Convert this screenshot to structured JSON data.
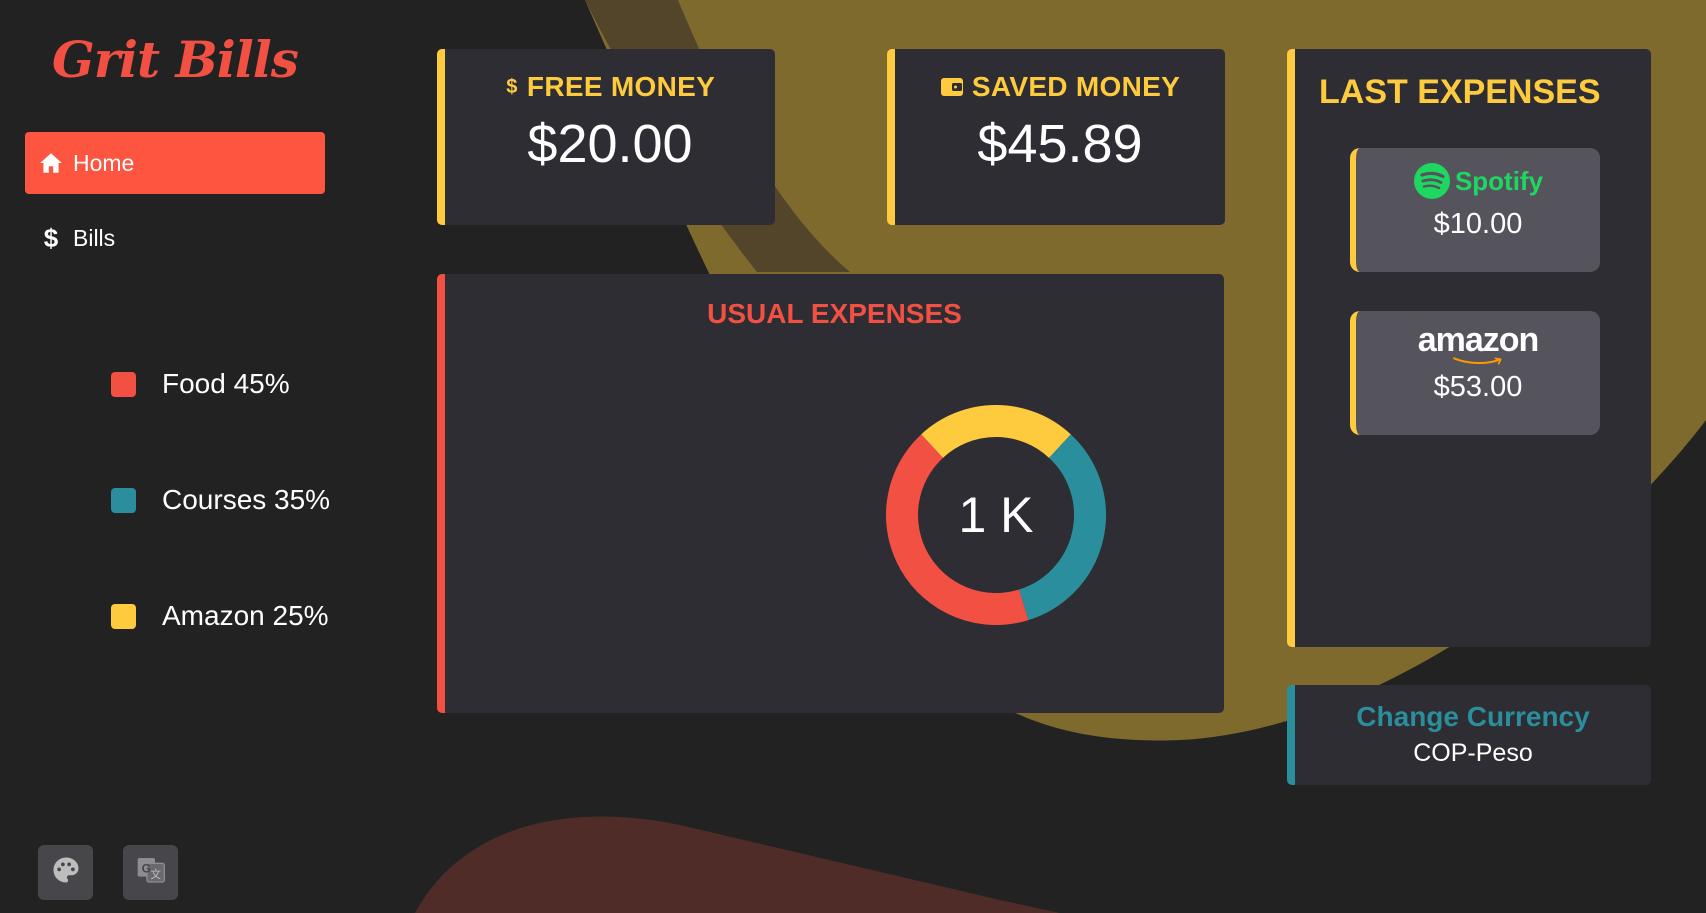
{
  "app": {
    "logo_text": "Grit Bills"
  },
  "sidebar": {
    "items": [
      {
        "label": "Home",
        "icon": "home-icon",
        "active": true
      },
      {
        "label": "Bills",
        "icon": "dollar-icon",
        "active": false
      }
    ],
    "tools": [
      {
        "icon": "palette-icon"
      },
      {
        "icon": "translate-icon"
      }
    ]
  },
  "summary": {
    "free_money": {
      "label": "FREE MONEY",
      "value": "$20.00",
      "icon": "dollar-icon"
    },
    "saved_money": {
      "label": "SAVED MONEY",
      "value": "$45.89",
      "icon": "wallet-icon"
    }
  },
  "usual_expenses": {
    "title": "USUAL EXPENSES",
    "center_label": "1 K",
    "legend": [
      {
        "label": "Food 45%",
        "color": "#f25042"
      },
      {
        "label": "Courses 35%",
        "color": "#2a8e9c"
      },
      {
        "label": "Amazon 25%",
        "color": "#ffcb3e"
      }
    ]
  },
  "chart_data": {
    "type": "pie",
    "title": "USUAL EXPENSES",
    "center_label": "1 K",
    "categories": [
      "Food",
      "Courses",
      "Amazon"
    ],
    "values": [
      45,
      35,
      25
    ],
    "colors": [
      "#f25042",
      "#2a8e9c",
      "#ffcb3e"
    ],
    "legend_position": "left"
  },
  "last_expenses": {
    "title": "LAST EXPENSES",
    "items": [
      {
        "brand": "Spotify",
        "amount": "$10.00",
        "logo": "spotify-logo"
      },
      {
        "brand": "amazon",
        "amount": "$53.00",
        "logo": "amazon-logo"
      }
    ]
  },
  "currency": {
    "label": "Change Currency",
    "value": "COP-Peso"
  },
  "colors": {
    "background": "#222223",
    "card": "#2d2d33",
    "accent_red": "#f25042",
    "accent_yellow": "#ffcb3e",
    "accent_teal": "#2a8e9c",
    "nav_active": "#fe5541",
    "expense_item": "#55545d"
  }
}
